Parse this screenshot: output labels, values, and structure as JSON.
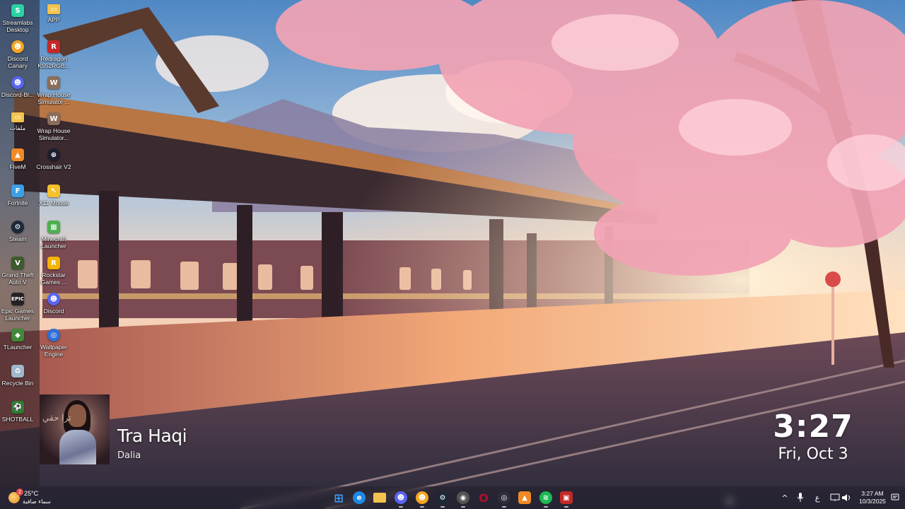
{
  "desktop_icons": [
    {
      "label": "Streamlabs Desktop",
      "icon": "streamlabs-icon",
      "color": "#2ad2a4"
    },
    {
      "label": "Discord Canary",
      "icon": "discord-canary-icon",
      "color": "#f5a623"
    },
    {
      "label": "Discord-Bl...",
      "icon": "discord-icon",
      "color": "#5865f2"
    },
    {
      "label": "ملفات",
      "icon": "folder-icon",
      "color": "#f3c34d"
    },
    {
      "label": "FiveM",
      "icon": "fivem-icon",
      "color": "#f08a24"
    },
    {
      "label": "Fortnite",
      "icon": "fortnite-icon",
      "color": "#3aa0e8"
    },
    {
      "label": "Steam",
      "icon": "steam-icon",
      "color": "#1b2838"
    },
    {
      "label": "Grand Theft Auto V",
      "icon": "gta-icon",
      "color": "#3c5a2e"
    },
    {
      "label": "Epic Games Launcher",
      "icon": "epic-games-icon",
      "color": "#222222"
    },
    {
      "label": "TLauncher",
      "icon": "tlauncher-icon",
      "color": "#3f8a3a"
    },
    {
      "label": "Recycle Bin",
      "icon": "recycle-bin-icon",
      "color": "#9fb8cc"
    },
    {
      "label": "SHOTBALL",
      "icon": "shotball-icon",
      "color": "#2e7d32"
    },
    {
      "label": "APP",
      "icon": "folder-icon",
      "color": "#f3c34d"
    },
    {
      "label": "Redragon K552RGB...",
      "icon": "redragon-icon",
      "color": "#c62828"
    },
    {
      "label": "Wrap House Simulator ...",
      "icon": "wrap-house-icon",
      "color": "#8a6d5a"
    },
    {
      "label": "Wrap House Simulator...",
      "icon": "wrap-house-icon",
      "color": "#8a6d5a"
    },
    {
      "label": "Crosshair V2",
      "icon": "crosshair-icon",
      "color": "#1e1e2e"
    },
    {
      "label": "X11 Mouse",
      "icon": "mouse-icon",
      "color": "#f6c02a"
    },
    {
      "label": "Minecraft Launcher",
      "icon": "minecraft-icon",
      "color": "#4caf50"
    },
    {
      "label": "Rockstar Games ...",
      "icon": "rockstar-icon",
      "color": "#f4b400"
    },
    {
      "label": "Discord",
      "icon": "discord-icon",
      "color": "#5865f2"
    },
    {
      "label": "Wallpaper Engine",
      "icon": "wallpaper-engine-icon",
      "color": "#2f6fd6"
    }
  ],
  "music": {
    "title": "Tra Haqi",
    "artist": "Dalia",
    "art_script": "ترا حقي"
  },
  "clock": {
    "time": "3:27",
    "date": "Fri, Oct 3"
  },
  "taskbar": {
    "weather": {
      "temp": "25°C",
      "condition": "سماء صافية",
      "badge": "2"
    },
    "apps": [
      {
        "name": "start-button",
        "icon": "windows-icon",
        "glyph": "⊞",
        "color": "#3aa0ff"
      },
      {
        "name": "taskbar-edge",
        "icon": "edge-icon",
        "glyph": "e",
        "color": "#1e88e5"
      },
      {
        "name": "taskbar-file-explorer",
        "icon": "file-explorer-icon",
        "glyph": "▭",
        "color": "#f3c34d"
      },
      {
        "name": "taskbar-discord",
        "icon": "discord-icon",
        "glyph": "☻",
        "color": "#5865f2"
      },
      {
        "name": "taskbar-discord-canary",
        "icon": "discord-canary-icon",
        "glyph": "☻",
        "color": "#f5a623"
      },
      {
        "name": "taskbar-steam",
        "icon": "steam-icon",
        "glyph": "⚙",
        "color": "#1b2838"
      },
      {
        "name": "taskbar-chrome",
        "icon": "chrome-icon",
        "glyph": "◉",
        "color": "#555555"
      },
      {
        "name": "taskbar-opera",
        "icon": "opera-icon",
        "glyph": "O",
        "color": "#b0102a"
      },
      {
        "name": "taskbar-obs",
        "icon": "obs-icon",
        "glyph": "◎",
        "color": "#302e3a"
      },
      {
        "name": "taskbar-fivem",
        "icon": "fivem-icon",
        "glyph": "▲",
        "color": "#f08a24"
      },
      {
        "name": "taskbar-spotify",
        "icon": "spotify-icon",
        "glyph": "≋",
        "color": "#1db954"
      },
      {
        "name": "taskbar-crosshair",
        "icon": "crosshair-app-icon",
        "glyph": "▣",
        "color": "#c62828"
      }
    ],
    "tray": {
      "chevron": "^",
      "language": "ع",
      "time": "3:27 AM",
      "date": "10/3/2025"
    }
  }
}
